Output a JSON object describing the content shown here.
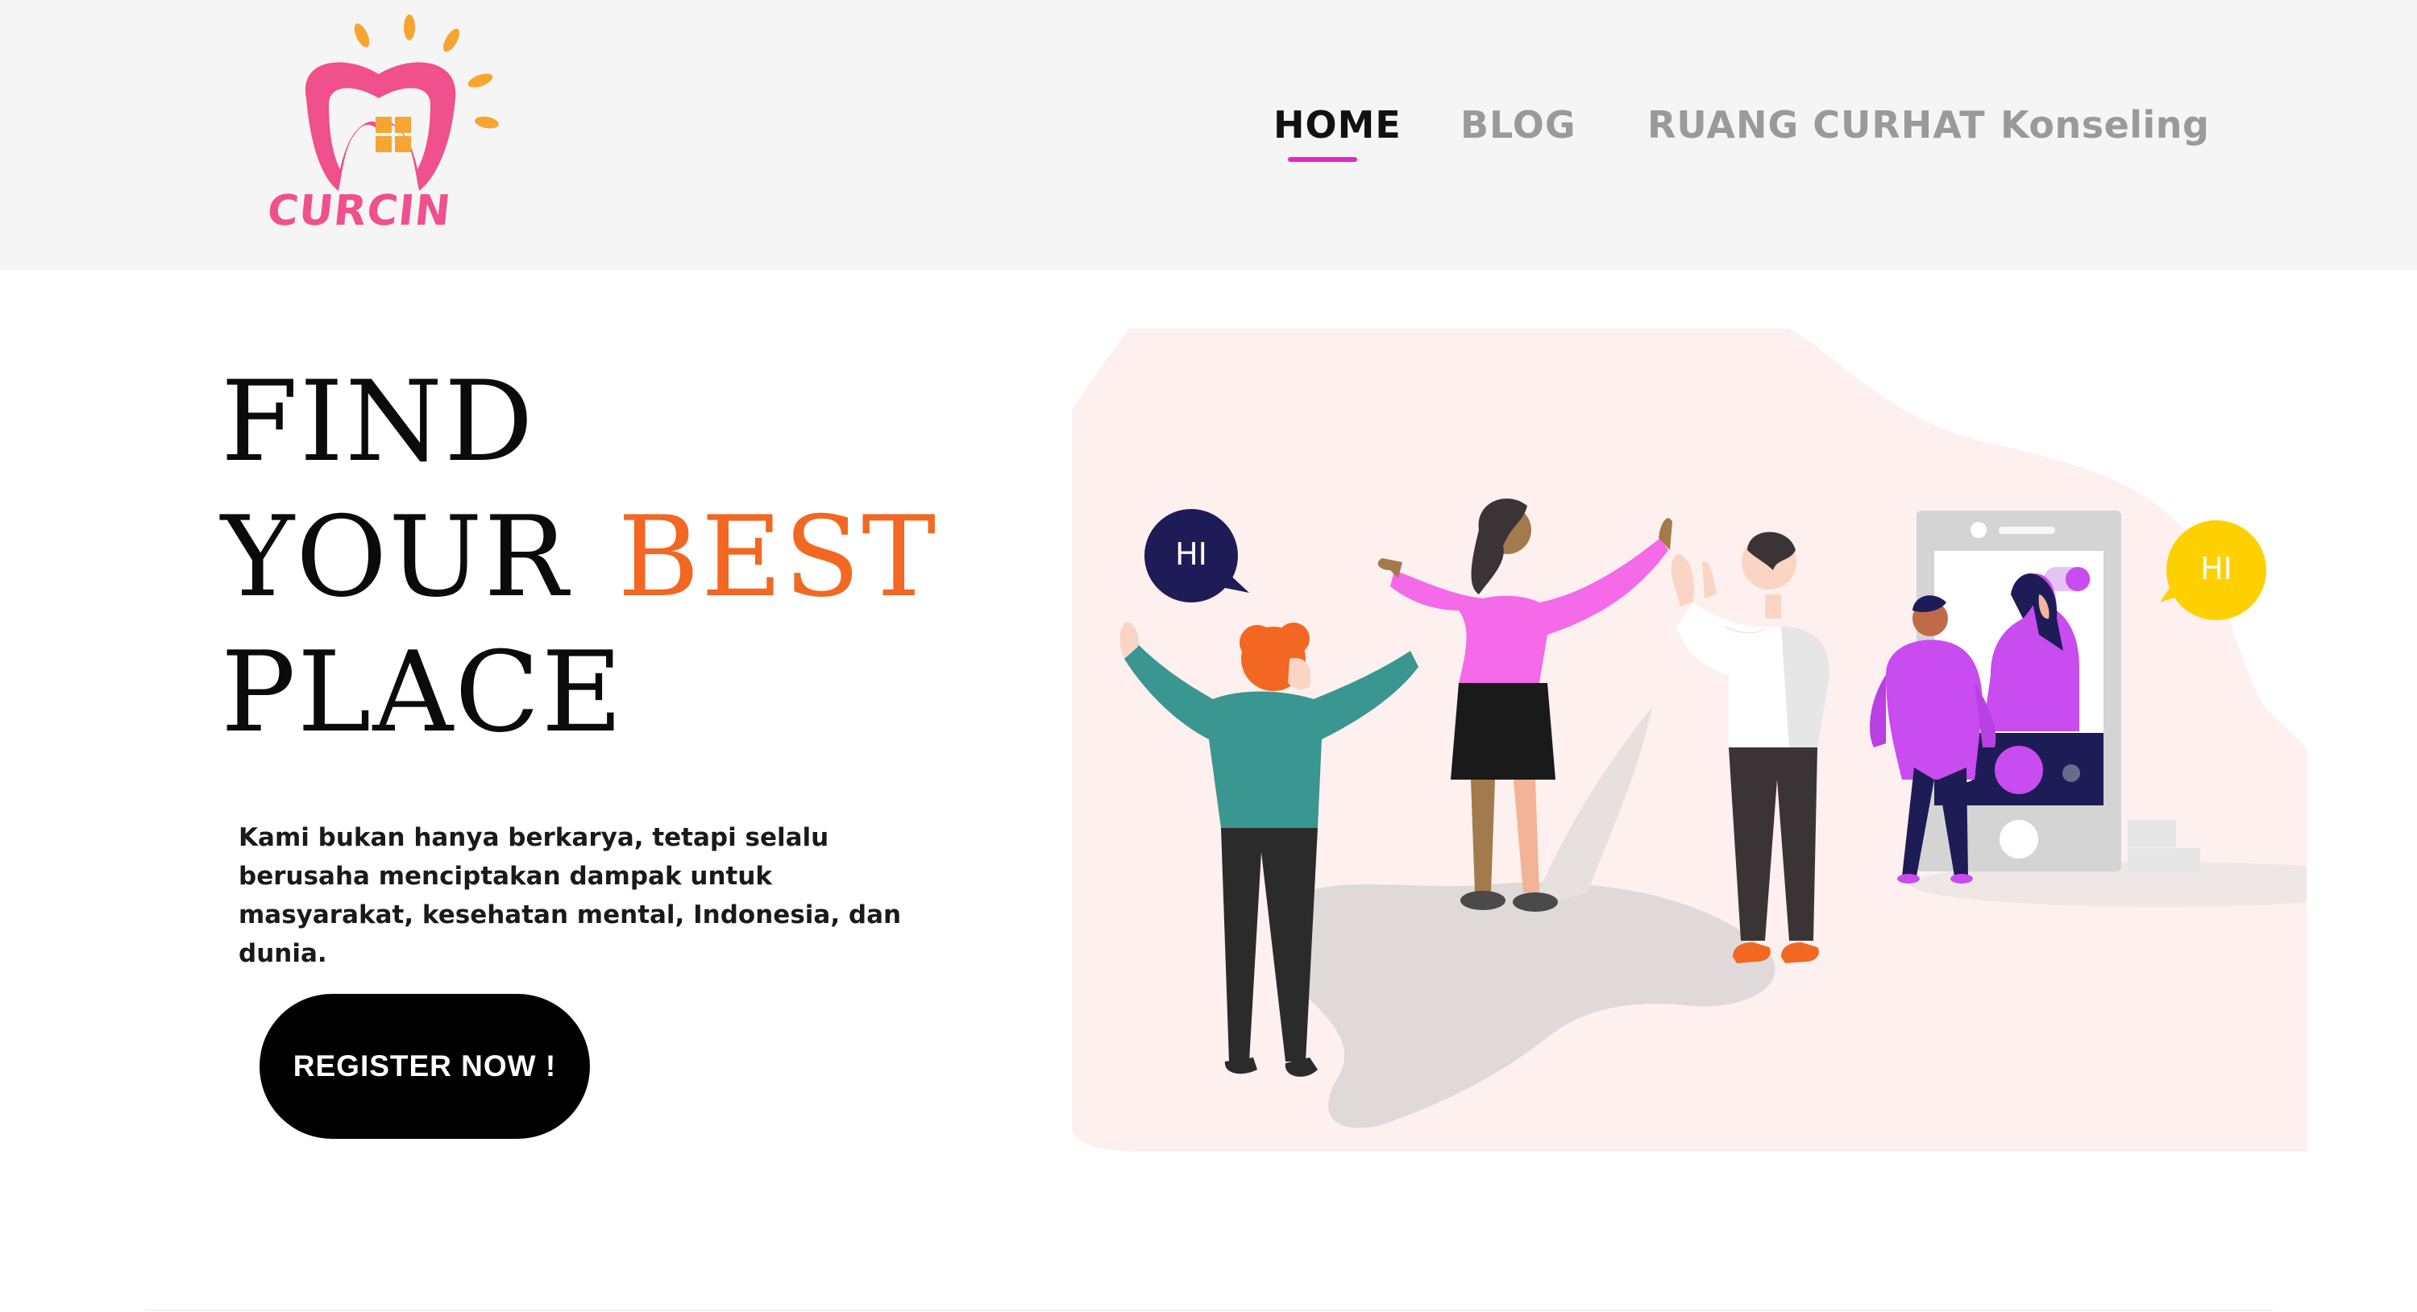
{
  "brand": {
    "name": "CURCIN",
    "colors": {
      "logo_pink": "#f0508c",
      "logo_orange": "#f7a531",
      "nav_active_underline": "#e626c8"
    }
  },
  "nav": {
    "items": [
      {
        "label": "HOME",
        "active": true
      },
      {
        "label": "BLOG",
        "active": false
      },
      {
        "label": "RUANG CURHAT",
        "active": false
      },
      {
        "label": "Konseling",
        "active": false
      }
    ]
  },
  "hero": {
    "title_line1": "FIND",
    "title_line2": "YOUR",
    "title_accent": "BEST",
    "title_line3": "PLACE",
    "accent_color": "#f26722",
    "description": "Kami bukan hanya berkarya, tetapi selalu berusaha menciptakan dampak untuk masyarakat, kesehatan mental, Indonesia, dan dunia.",
    "cta_label": "REGISTER NOW !"
  },
  "illustration": {
    "bubble_left": "HI",
    "bubble_right": "HI",
    "colors": {
      "blob": "#fdf0ef",
      "bubble_left": "#1e1c56",
      "bubble_right": "#ffd000",
      "phone": "#d4d4d4",
      "phone_screen_bar": "#1e1c56",
      "call_button": "#c84cf0"
    }
  }
}
